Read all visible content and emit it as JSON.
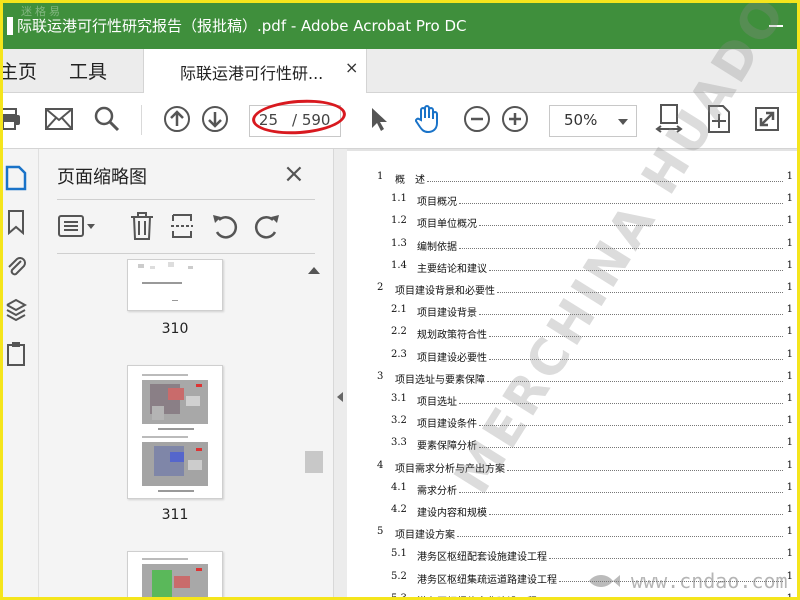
{
  "window": {
    "title": "际联运港可行性研究报告（报批稿）.pdf - Adobe Acrobat Pro DC",
    "corner_watermark": "迷格易"
  },
  "tabs": {
    "home": "主页",
    "tools": "工具",
    "document": "际联运港可行性研...",
    "close": "×"
  },
  "toolbar": {
    "page_current": "25",
    "page_total": "/ 590",
    "zoom": "50%"
  },
  "thumbnails_panel": {
    "title": "页面缩略图",
    "close": "×",
    "pages": [
      {
        "label": "310"
      },
      {
        "label": "311"
      }
    ]
  },
  "toc": [
    {
      "num": "1",
      "text": "概　述",
      "page": "1",
      "level": 1
    },
    {
      "num": "1.1",
      "text": "项目概况",
      "page": "1",
      "level": 2
    },
    {
      "num": "1.2",
      "text": "项目单位概况",
      "page": "1",
      "level": 2
    },
    {
      "num": "1.3",
      "text": "编制依据",
      "page": "1",
      "level": 2
    },
    {
      "num": "1.4",
      "text": "主要结论和建议",
      "page": "1",
      "level": 2
    },
    {
      "num": "2",
      "text": "项目建设背景和必要性",
      "page": "1",
      "level": 1
    },
    {
      "num": "2.1",
      "text": "项目建设背景",
      "page": "1",
      "level": 2
    },
    {
      "num": "2.2",
      "text": "规划政策符合性",
      "page": "1",
      "level": 2
    },
    {
      "num": "2.3",
      "text": "项目建设必要性",
      "page": "1",
      "level": 2
    },
    {
      "num": "3",
      "text": "项目选址与要素保障",
      "page": "1",
      "level": 1
    },
    {
      "num": "3.1",
      "text": "项目选址",
      "page": "1",
      "level": 2
    },
    {
      "num": "3.2",
      "text": "项目建设条件",
      "page": "1",
      "level": 2
    },
    {
      "num": "3.3",
      "text": "要素保障分析",
      "page": "1",
      "level": 2
    },
    {
      "num": "4",
      "text": "项目需求分析与产出方案",
      "page": "1",
      "level": 1
    },
    {
      "num": "4.1",
      "text": "需求分析",
      "page": "1",
      "level": 2
    },
    {
      "num": "4.2",
      "text": "建设内容和规模",
      "page": "1",
      "level": 2
    },
    {
      "num": "5",
      "text": "项目建设方案",
      "page": "1",
      "level": 1
    },
    {
      "num": "5.1",
      "text": "港务区枢纽配套设施建设工程",
      "page": "1",
      "level": 2
    },
    {
      "num": "5.2",
      "text": "港务区枢纽集疏运道路建设工程",
      "page": "1",
      "level": 2
    },
    {
      "num": "5.3",
      "text": "港务区枢纽信息化建设工程",
      "page": "1",
      "level": 2
    }
  ],
  "page_watermark": "MERCHINA HUADONG",
  "site_watermark": "www.cndao.com"
}
